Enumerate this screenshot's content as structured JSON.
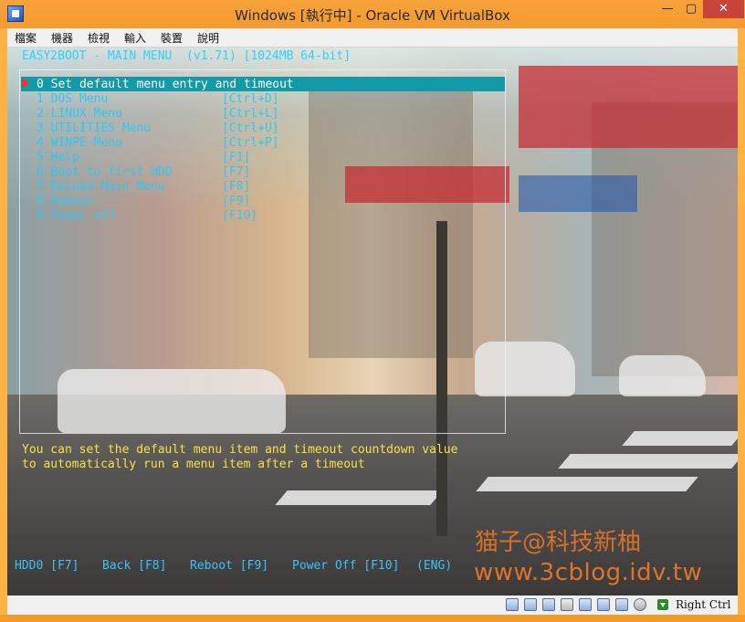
{
  "window": {
    "title": "Windows  [執行中] - Oracle VM VirtualBox",
    "minimize_glyph": "—",
    "maximize_glyph": "▢",
    "close_glyph": "✕"
  },
  "menubar": {
    "items": [
      "檔案",
      "機器",
      "檢視",
      "輸入",
      "裝置",
      "說明"
    ]
  },
  "vm": {
    "header": "EASY2BOOT - MAIN MENU  (v1.71) [1024MB 64-bit]",
    "selected_index": 0,
    "entries": [
      {
        "label": "0 Set default menu entry and timeout",
        "key": ""
      },
      {
        "label": "1 DOS Menu",
        "key": "[Ctrl+D]"
      },
      {
        "label": "2 LINUX Menu",
        "key": "[Ctrl+L]"
      },
      {
        "label": "3 UTILITIES Menu",
        "key": "[Ctrl+U]"
      },
      {
        "label": "4 WINPE Menu",
        "key": "[Ctrl+P]"
      },
      {
        "label": "5 Help",
        "key": "[F1]"
      },
      {
        "label": "6 Boot to first HDD",
        "key": "[F7]"
      },
      {
        "label": "7 Reload Main Menu",
        "key": "[F8]"
      },
      {
        "label": "8 Reboot",
        "key": "[F9]"
      },
      {
        "label": "9 Power off",
        "key": "[F10]"
      }
    ],
    "help_lines": [
      "You can set the default menu item and timeout countdown value",
      "to automatically run a menu item after a timeout"
    ],
    "footer": [
      {
        "name": "footer-hdd0",
        "text": "HDD0 [F7]"
      },
      {
        "name": "footer-back",
        "text": "Back [F8]"
      },
      {
        "name": "footer-reboot",
        "text": "Reboot [F9]"
      },
      {
        "name": "footer-poweroff",
        "text": "Power Off [F10]"
      },
      {
        "name": "footer-language",
        "text": "(ENG)"
      }
    ],
    "watermark_cn": "猫子@科技新柚",
    "watermark_url": "www.3cblog.idv.tw"
  },
  "statusbar": {
    "icons": [
      "hard-disk-icon",
      "optical-drive-icon",
      "usb-icon",
      "shared-folder-icon",
      "display-icon",
      "network-icon",
      "video-capture-icon",
      "vrde-icon",
      "mouse-integration-icon"
    ],
    "host_key": "Right Ctrl"
  },
  "colors": {
    "title_bar": "#f39a2f",
    "selection_bar": "#149aa6",
    "menu_text": "#33c7f0",
    "help_text": "#f5e04a",
    "header_text": "#2fd1ff"
  }
}
